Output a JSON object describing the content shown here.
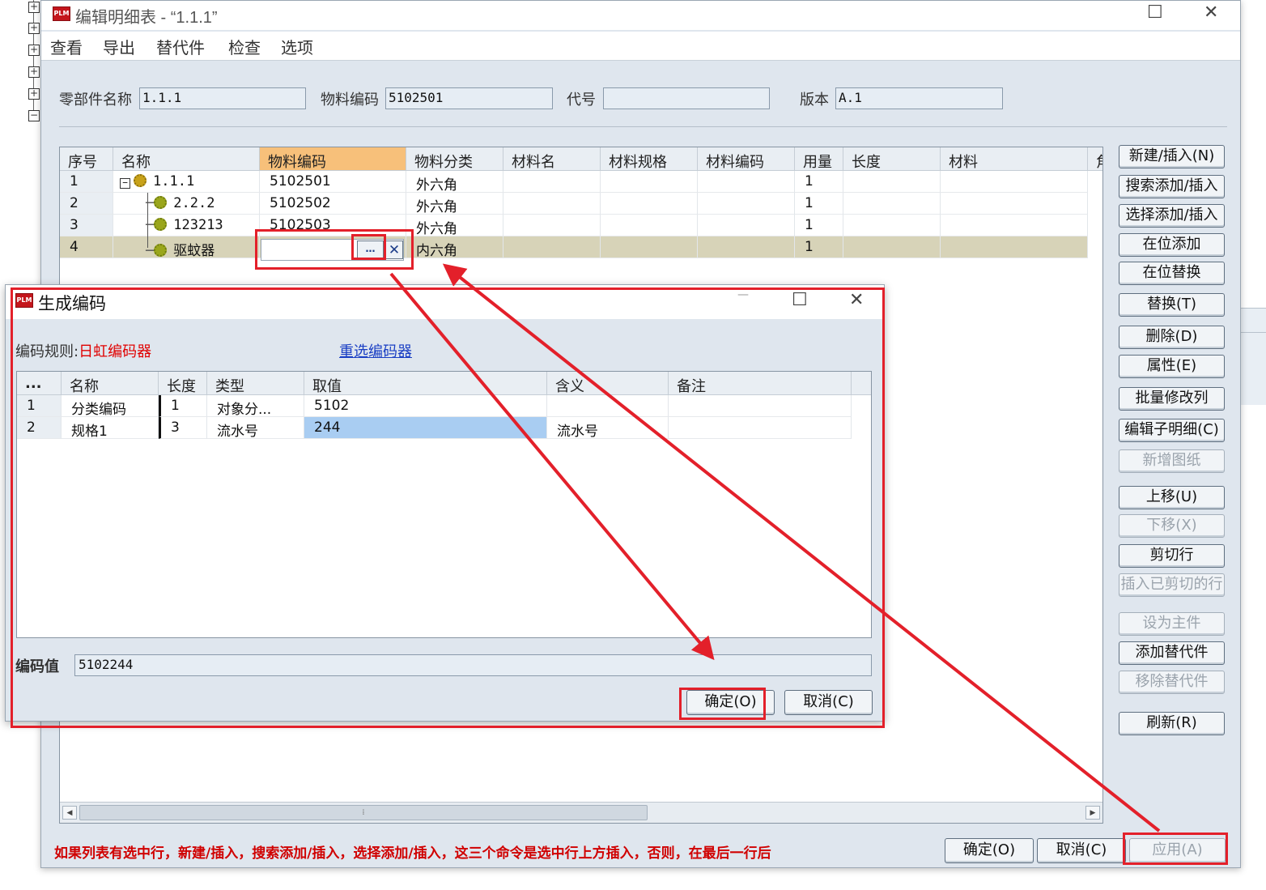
{
  "main_window": {
    "title": "编辑明细表 - “1.1.1”",
    "logo": "PLM",
    "controls": {
      "maximize": "☐",
      "close": "✕"
    },
    "menu": [
      "查看",
      "导出",
      "替代件",
      "检查",
      "选项"
    ],
    "fields": {
      "part_name_label": "零部件名称",
      "part_name_value": "1.1.1",
      "material_code_label": "物料编码",
      "material_code_value": "5102501",
      "code_label": "代号",
      "code_value": "",
      "version_label": "版本",
      "version_value": "A.1"
    },
    "table": {
      "columns": [
        "序号",
        "名称",
        "物料编码",
        "物料分类",
        "材料名",
        "材料规格",
        "材料编码",
        "用量",
        "长度",
        "材料",
        "角"
      ],
      "rows": [
        {
          "seq": "1",
          "name": "1.1.1",
          "code": "5102501",
          "category": "外六角",
          "qty": "1"
        },
        {
          "seq": "2",
          "name": "2.2.2",
          "code": "5102502",
          "category": "外六角",
          "qty": "1"
        },
        {
          "seq": "3",
          "name": "123213",
          "code": "5102503",
          "category": "外六角",
          "qty": "1"
        },
        {
          "seq": "4",
          "name": "驱蚊器",
          "code": "",
          "category": "内六角",
          "qty": "1"
        }
      ],
      "ellipsis": "…",
      "clear": "✕"
    },
    "side_buttons": [
      {
        "label": "新建/插入(N)",
        "enabled": true
      },
      {
        "label": "搜索添加/插入",
        "enabled": true
      },
      {
        "label": "选择添加/插入",
        "enabled": true
      },
      {
        "label": "在位添加",
        "enabled": true
      },
      {
        "label": "在位替换",
        "enabled": true
      },
      {
        "label": "替换(T)",
        "enabled": true
      },
      {
        "label": "删除(D)",
        "enabled": true
      },
      {
        "label": "属性(E)",
        "enabled": true
      },
      {
        "label": "批量修改列",
        "enabled": true
      },
      {
        "label": "编辑子明细(C)",
        "enabled": true
      },
      {
        "label": "新增图纸",
        "enabled": false
      },
      {
        "label": "上移(U)",
        "enabled": true
      },
      {
        "label": "下移(X)",
        "enabled": false
      },
      {
        "label": "剪切行",
        "enabled": true
      },
      {
        "label": "插入已剪切的行",
        "enabled": false
      },
      {
        "label": "设为主件",
        "enabled": false
      },
      {
        "label": "添加替代件",
        "enabled": true
      },
      {
        "label": "移除替代件",
        "enabled": false
      },
      {
        "label": "刷新(R)",
        "enabled": true
      }
    ],
    "note": "如果列表有选中行，新建/插入，搜索添加/插入，选择添加/插入，这三个命令是选中行上方插入，否则，在最后一行后",
    "footer": {
      "ok": "确定(O)",
      "cancel": "取消(C)",
      "apply": "应用(A)"
    }
  },
  "dialog": {
    "title": "生成编码",
    "logo": "PLM",
    "controls": {
      "minimize": "—",
      "maximize": "☐",
      "close": "✕"
    },
    "rule_label": "编码规则:",
    "rule_value": "日虹编码器",
    "reselect": "重选编码器",
    "table": {
      "columns": [
        "...",
        "名称",
        "长度",
        "类型",
        "取值",
        "含义",
        "备注"
      ],
      "rows": [
        {
          "idx": "1",
          "name": "分类编码",
          "length": "1",
          "type": "对象分...",
          "value": "5102",
          "meaning": "",
          "remark": ""
        },
        {
          "idx": "2",
          "name": "规格1",
          "length": "3",
          "type": "流水号",
          "value": "244",
          "meaning": "流水号",
          "remark": ""
        }
      ]
    },
    "encode_label": "编码值",
    "encode_value": "5102244",
    "ok": "确定(O)",
    "cancel": "取消(C)"
  },
  "colors": {
    "annotation": "#e3202a",
    "highlight_header": "#f7c07a",
    "selected_row": "#d7d3b8",
    "selected_cell": "#a9cdf2",
    "note_text": "#d00000",
    "link": "#1a3fc4"
  }
}
